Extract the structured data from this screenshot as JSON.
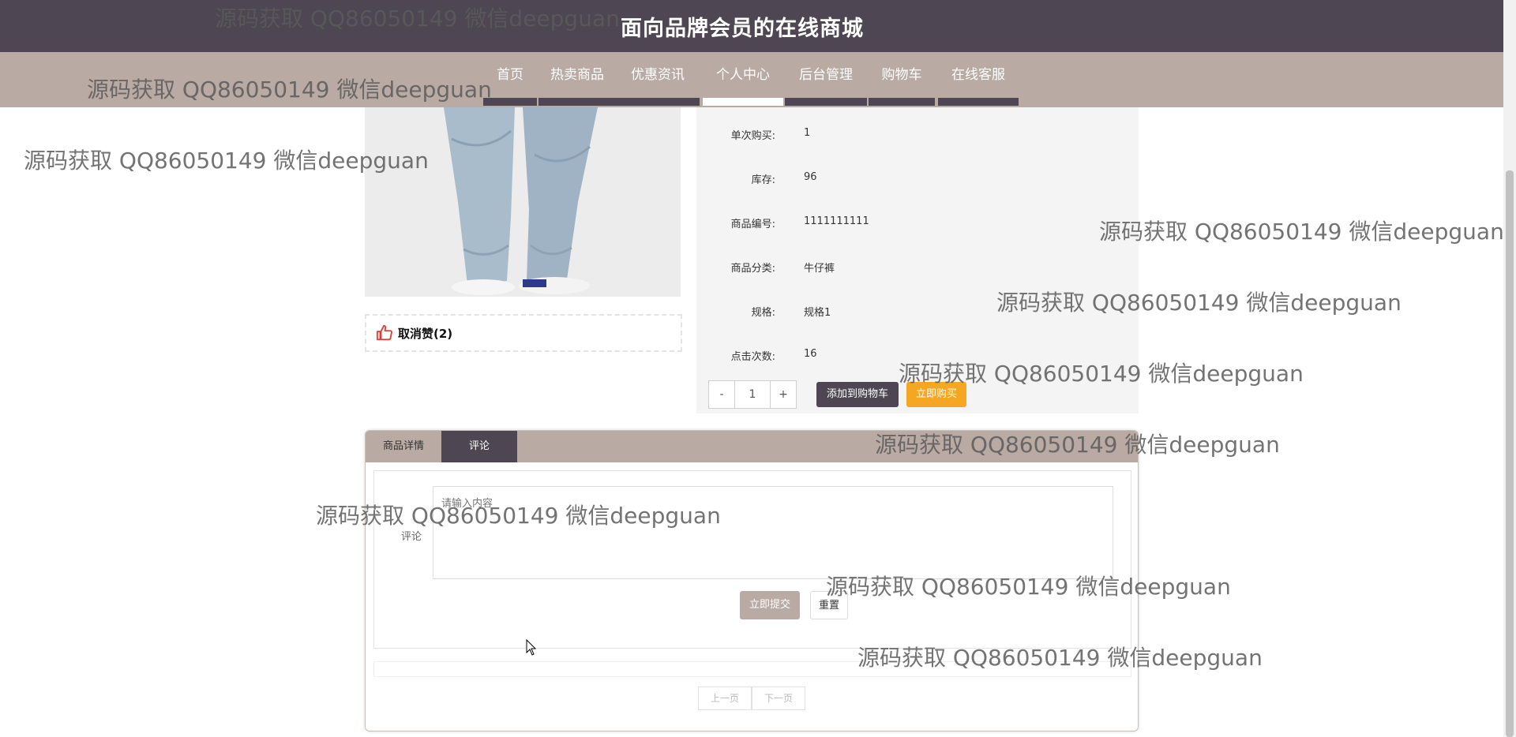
{
  "header": {
    "title": "面向品牌会员的在线商城"
  },
  "nav": {
    "items": [
      {
        "label": "首页"
      },
      {
        "label": "热卖商品"
      },
      {
        "label": "优惠资讯"
      },
      {
        "label": "个人中心"
      },
      {
        "label": "后台管理"
      },
      {
        "label": "购物车"
      },
      {
        "label": "在线客服"
      }
    ],
    "active": "个人中心"
  },
  "like": {
    "label": "取消赞(2)"
  },
  "product_info": [
    {
      "label": "单次购买:",
      "value": "1"
    },
    {
      "label": "库存:",
      "value": "96"
    },
    {
      "label": "商品编号:",
      "value": "1111111111"
    },
    {
      "label": "商品分类:",
      "value": "牛仔裤"
    },
    {
      "label": "规格:",
      "value": "规格1"
    },
    {
      "label": "点击次数:",
      "value": "16"
    }
  ],
  "quantity": {
    "minus": "-",
    "value": "1",
    "plus": "+"
  },
  "actions": {
    "add_to_cart": "添加到购物车",
    "buy_now": "立即购买"
  },
  "tabs": [
    {
      "label": "商品详情"
    },
    {
      "label": "评论"
    }
  ],
  "comment": {
    "label": "评论",
    "placeholder": "请输入内容",
    "submit": "立即提交",
    "reset": "重置"
  },
  "pagination": {
    "prev": "上一页",
    "next": "下一页"
  },
  "watermark": "源码获取 QQ86050149 微信deepguan",
  "colors": {
    "header_bg": "#4e4652",
    "nav_bg": "#b9aaa3",
    "buy_now": "#f5a623",
    "like_icon": "#e53935"
  }
}
